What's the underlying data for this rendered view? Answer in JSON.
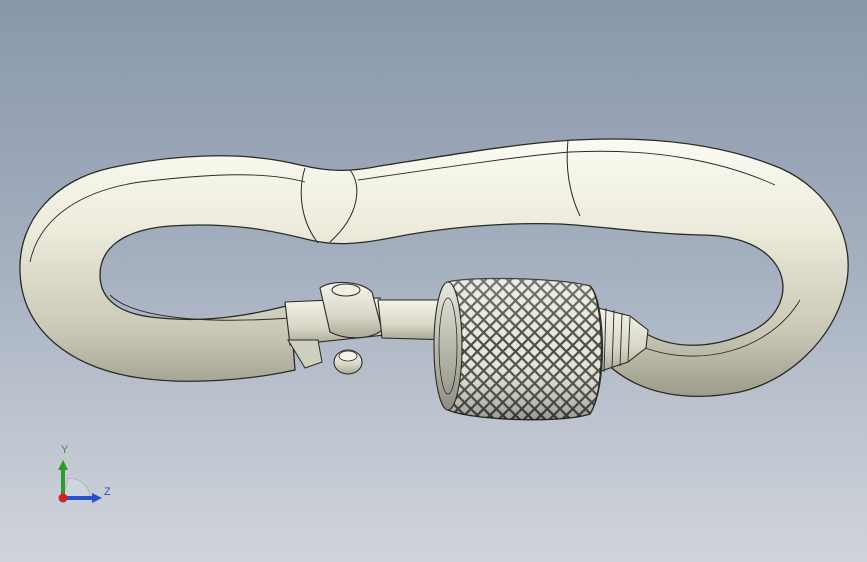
{
  "viewport": {
    "background_top": "#8a97ab",
    "background_bottom": "#cfd3da",
    "model": "carabiner-screw-lock-icon"
  },
  "triad": {
    "y_label": "Y",
    "z_label": "Z",
    "y_color": "#2e9a2e",
    "z_color": "#2c4fd0",
    "x_color": "#d0202a"
  }
}
